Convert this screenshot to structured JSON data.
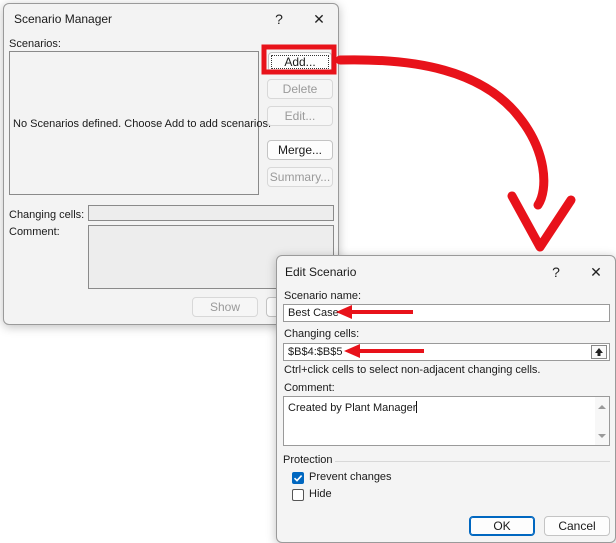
{
  "scenario_manager": {
    "title": "Scenario Manager",
    "help_glyph": "?",
    "close_glyph": "✕",
    "scenarios_label": "Scenarios:",
    "empty_message": "No Scenarios defined. Choose Add to add scenarios.",
    "buttons": {
      "add": "Add...",
      "delete": "Delete",
      "edit": "Edit...",
      "merge": "Merge...",
      "summary": "Summary...",
      "show": "Show"
    },
    "changing_cells_label": "Changing cells:",
    "comment_label": "Comment:"
  },
  "edit_scenario": {
    "title": "Edit Scenario",
    "help_glyph": "?",
    "close_glyph": "✕",
    "scenario_name_label": "Scenario name:",
    "scenario_name_value": "Best Case",
    "changing_cells_label": "Changing cells:",
    "changing_cells_value": "$B$4:$B$5",
    "hint": "Ctrl+click cells to select non-adjacent changing cells.",
    "comment_label": "Comment:",
    "comment_value": "Created by Plant Manager",
    "protection_label": "Protection",
    "prevent_changes_label": "Prevent changes",
    "prevent_changes_checked": true,
    "hide_label": "Hide",
    "hide_checked": false,
    "ok_label": "OK",
    "cancel_label": "Cancel"
  },
  "annotations": {
    "highlight_color": "#e8121a",
    "icons": [
      "collapse-dialog-icon",
      "checkmark-icon",
      "scroll-up-icon",
      "scroll-down-icon"
    ]
  }
}
